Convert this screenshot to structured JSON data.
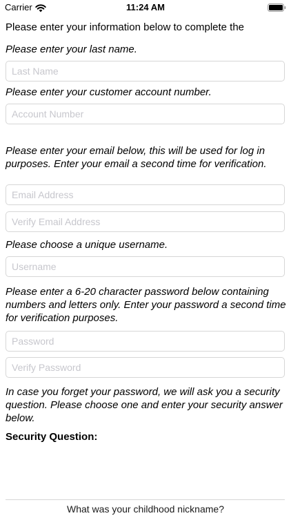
{
  "status_bar": {
    "carrier": "Carrier",
    "time": "11:24 AM"
  },
  "intro": "Please enter your information below to complete the",
  "last_name": {
    "prompt": "Please enter your last name.",
    "placeholder": "Last Name"
  },
  "account": {
    "prompt": "Please enter your customer account number.",
    "placeholder": "Account Number"
  },
  "email": {
    "prompt": "Please enter your email below, this will be used for log in purposes.  Enter your email a second time for verification.",
    "placeholder": "Email Address",
    "verify_placeholder": "Verify Email Address"
  },
  "username": {
    "prompt": "Please choose a unique username.",
    "placeholder": "Username"
  },
  "password": {
    "prompt": "Please enter a 6-20 character password below containing numbers and letters only. Enter your password a second time for verification purposes.",
    "placeholder": "Password",
    "verify_placeholder": "Verify Password"
  },
  "security": {
    "prompt": "In case you forget your password, we will ask you a security question. Please choose one and enter your security answer below.",
    "label": "Security Question:",
    "selected_question": "What was your childhood nickname?"
  }
}
